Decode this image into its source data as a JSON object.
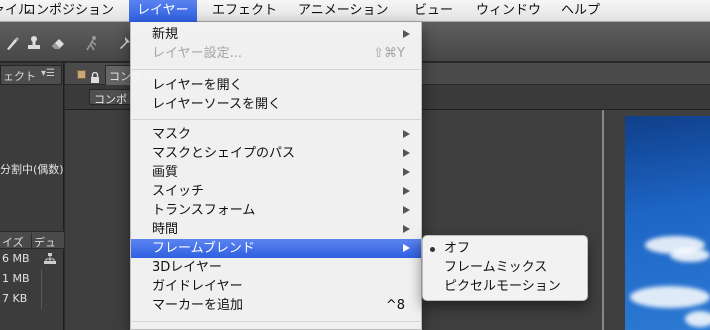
{
  "menubar": {
    "items": [
      {
        "label": "ァイル"
      },
      {
        "label": "コンポジション"
      },
      {
        "label": "レイヤー"
      },
      {
        "label": "エフェクト"
      },
      {
        "label": "アニメーション"
      },
      {
        "label": "ビュー"
      },
      {
        "label": "ウィンドウ"
      },
      {
        "label": "ヘルプ"
      }
    ]
  },
  "left_panel": {
    "tab_label": "ェクト",
    "tab_menu": "▾☰",
    "field_info": "分割中(偶数)",
    "col_size": "イズ",
    "col_duration": "デュ",
    "rows": [
      {
        "size": "6 MB"
      },
      {
        "size": "1 MB"
      },
      {
        "size": "7 KB"
      }
    ]
  },
  "comp_panel": {
    "tab_label": "コンポ",
    "subtab_label": "コンポ"
  },
  "layer_menu": {
    "new": "新規",
    "settings": "レイヤー設定...",
    "settings_shortcut": "⇧⌘Y",
    "open_layer": "レイヤーを開く",
    "open_source": "レイヤーソースを開く",
    "mask": "マスク",
    "mask_shape_path": "マスクとシェイプのパス",
    "quality": "画質",
    "switches": "スイッチ",
    "transform": "トランスフォーム",
    "time": "時間",
    "frame_blend": "フレームブレンド",
    "layer_3d": "3Dレイヤー",
    "guide_layer": "ガイドレイヤー",
    "add_marker": "マーカーを追加",
    "add_marker_shortcut": "^8"
  },
  "blend_submenu": {
    "items": [
      {
        "label": "オフ",
        "checked": true
      },
      {
        "label": "フレームミックス",
        "checked": false
      },
      {
        "label": "ピクセルモーション",
        "checked": false
      }
    ]
  }
}
